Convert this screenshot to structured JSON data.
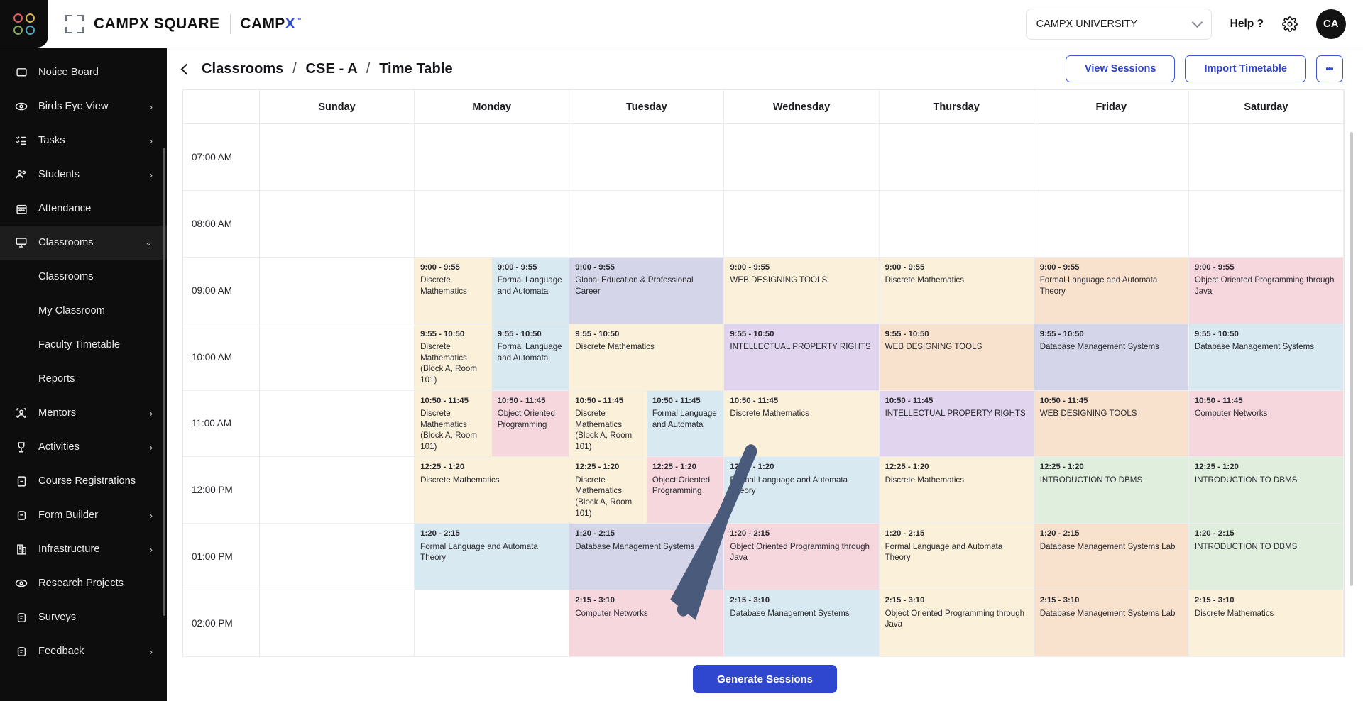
{
  "topbar": {
    "brand_name": "CAMPX SQUARE",
    "brand_sub": "CAMP",
    "brand_sub_x": "X",
    "brand_tm": "™",
    "org": "CAMPX UNIVERSITY",
    "help": "Help ?",
    "avatar": "CA"
  },
  "sidebar": {
    "items": [
      {
        "label": "Notice Board",
        "icon": "board-icon",
        "arrow": "",
        "active": false
      },
      {
        "label": "Birds Eye View",
        "icon": "eye-icon",
        "arrow": "›",
        "active": false
      },
      {
        "label": "Tasks",
        "icon": "tasks-icon",
        "arrow": "›",
        "active": false
      },
      {
        "label": "Students",
        "icon": "students-icon",
        "arrow": "›",
        "active": false
      },
      {
        "label": "Attendance",
        "icon": "calendar-icon",
        "arrow": "",
        "active": false
      },
      {
        "label": "Classrooms",
        "icon": "monitor-icon",
        "arrow": "⌄",
        "active": true
      }
    ],
    "sub_items": [
      {
        "label": "Classrooms"
      },
      {
        "label": "My Classroom"
      },
      {
        "label": "Faculty Timetable"
      },
      {
        "label": "Reports"
      }
    ],
    "items2": [
      {
        "label": "Mentors",
        "icon": "mentor-icon",
        "arrow": "›"
      },
      {
        "label": "Activities",
        "icon": "trophy-icon",
        "arrow": "›"
      },
      {
        "label": "Course Registrations",
        "icon": "doc-icon",
        "arrow": ""
      },
      {
        "label": "Form Builder",
        "icon": "form-icon",
        "arrow": "›"
      },
      {
        "label": "Infrastructure",
        "icon": "building-icon",
        "arrow": "›"
      },
      {
        "label": "Research Projects",
        "icon": "eye-icon",
        "arrow": ""
      },
      {
        "label": "Surveys",
        "icon": "survey-icon",
        "arrow": ""
      },
      {
        "label": "Feedback",
        "icon": "feedback-icon",
        "arrow": "›"
      }
    ]
  },
  "page": {
    "breadcrumb_1": "Classrooms",
    "breadcrumb_2": "CSE - A",
    "breadcrumb_3": "Time Table",
    "sep": "/",
    "btn_view_sessions": "View Sessions",
    "btn_import_timetable": "Import Timetable",
    "btn_generate_sessions": "Generate Sessions"
  },
  "calendar": {
    "days": [
      "Sunday",
      "Monday",
      "Tuesday",
      "Wednesday",
      "Thursday",
      "Friday",
      "Saturday"
    ],
    "times": [
      "07:00 AM",
      "08:00 AM",
      "09:00 AM",
      "10:00 AM",
      "11:00 AM",
      "12:00 PM",
      "01:00 PM",
      "02:00 PM"
    ],
    "colors": {
      "cream": "#fbf0d9",
      "blue": "#d9e9f2",
      "lavender": "#d4d5e8",
      "purple": "#e0d4ee",
      "peach": "#f9e2cd",
      "pink": "#f6d7de",
      "green": "#dfeedd"
    },
    "rows": [
      {
        "time": "07:00 AM",
        "cells": [
          [],
          [],
          [],
          [],
          [],
          [],
          []
        ]
      },
      {
        "time": "08:00 AM",
        "cells": [
          [],
          [],
          [],
          [],
          [],
          [],
          []
        ]
      },
      {
        "time": "09:00 AM",
        "cells": [
          [],
          [
            {
              "time": "9:00 - 9:55",
              "name": "Discrete Mathematics",
              "color": "cream"
            },
            {
              "time": "9:00 - 9:55",
              "name": "Formal Language and Automata",
              "color": "blue"
            }
          ],
          [
            {
              "time": "9:00 - 9:55",
              "name": "Global Education & Professional Career",
              "color": "lavender"
            }
          ],
          [
            {
              "time": "9:00 - 9:55",
              "name": "WEB DESIGNING TOOLS",
              "color": "cream"
            }
          ],
          [
            {
              "time": "9:00 - 9:55",
              "name": "Discrete Mathematics",
              "color": "cream"
            }
          ],
          [
            {
              "time": "9:00 - 9:55",
              "name": "Formal Language and Automata Theory",
              "color": "peach"
            }
          ],
          [
            {
              "time": "9:00 - 9:55",
              "name": "Object Oriented Programming through Java",
              "color": "pink"
            }
          ]
        ]
      },
      {
        "time": "10:00 AM",
        "cells": [
          [],
          [
            {
              "time": "9:55 - 10:50",
              "name": "Discrete Mathematics (Block A, Room 101)",
              "color": "cream"
            },
            {
              "time": "9:55 - 10:50",
              "name": "Formal Language and Automata",
              "color": "blue"
            }
          ],
          [
            {
              "time": "9:55 - 10:50",
              "name": "Discrete Mathematics",
              "color": "cream"
            }
          ],
          [
            {
              "time": "9:55 - 10:50",
              "name": "INTELLECTUAL PROPERTY RIGHTS",
              "color": "purple"
            }
          ],
          [
            {
              "time": "9:55 - 10:50",
              "name": "WEB DESIGNING TOOLS",
              "color": "peach"
            }
          ],
          [
            {
              "time": "9:55 - 10:50",
              "name": "Database Management Systems",
              "color": "lavender"
            }
          ],
          [
            {
              "time": "9:55 - 10:50",
              "name": "Database Management Systems",
              "color": "blue"
            }
          ]
        ]
      },
      {
        "time": "11:00 AM",
        "cells": [
          [],
          [
            {
              "time": "10:50 - 11:45",
              "name": "Discrete Mathematics (Block A, Room 101)",
              "color": "cream"
            },
            {
              "time": "10:50 - 11:45",
              "name": "Object Oriented Programming",
              "color": "pink"
            }
          ],
          [
            {
              "time": "10:50 - 11:45",
              "name": "Discrete Mathematics (Block A, Room 101)",
              "color": "cream"
            },
            {
              "time": "10:50 - 11:45",
              "name": "Formal Language and Automata",
              "color": "blue"
            }
          ],
          [
            {
              "time": "10:50 - 11:45",
              "name": "Discrete Mathematics",
              "color": "cream"
            }
          ],
          [
            {
              "time": "10:50 - 11:45",
              "name": "INTELLECTUAL PROPERTY RIGHTS",
              "color": "purple"
            }
          ],
          [
            {
              "time": "10:50 - 11:45",
              "name": "WEB DESIGNING TOOLS",
              "color": "peach"
            }
          ],
          [
            {
              "time": "10:50 - 11:45",
              "name": "Computer Networks",
              "color": "pink"
            }
          ]
        ]
      },
      {
        "time": "12:00 PM",
        "cells": [
          [],
          [
            {
              "time": "12:25 - 1:20",
              "name": "Discrete Mathematics",
              "color": "cream"
            }
          ],
          [
            {
              "time": "12:25 - 1:20",
              "name": "Discrete Mathematics (Block A, Room 101)",
              "color": "cream"
            },
            {
              "time": "12:25 - 1:20",
              "name": "Object Oriented Programming",
              "color": "pink"
            }
          ],
          [
            {
              "time": "12:25 - 1:20",
              "name": "Formal Language and Automata Theory",
              "color": "blue"
            }
          ],
          [
            {
              "time": "12:25 - 1:20",
              "name": "Discrete Mathematics",
              "color": "cream"
            }
          ],
          [
            {
              "time": "12:25 - 1:20",
              "name": "INTRODUCTION TO DBMS",
              "color": "green"
            }
          ],
          [
            {
              "time": "12:25 - 1:20",
              "name": "INTRODUCTION TO DBMS",
              "color": "green"
            }
          ]
        ]
      },
      {
        "time": "01:00 PM",
        "cells": [
          [],
          [
            {
              "time": "1:20 - 2:15",
              "name": "Formal Language and Automata Theory",
              "color": "blue"
            }
          ],
          [
            {
              "time": "1:20 - 2:15",
              "name": "Database Management Systems",
              "color": "lavender"
            }
          ],
          [
            {
              "time": "1:20 - 2:15",
              "name": "Object Oriented Programming through Java",
              "color": "pink"
            }
          ],
          [
            {
              "time": "1:20 - 2:15",
              "name": "Formal Language and Automata Theory",
              "color": "cream"
            }
          ],
          [
            {
              "time": "1:20 - 2:15",
              "name": "Database Management Systems Lab",
              "color": "peach"
            }
          ],
          [
            {
              "time": "1:20 - 2:15",
              "name": "INTRODUCTION TO DBMS",
              "color": "green"
            }
          ]
        ]
      },
      {
        "time": "02:00 PM",
        "cells": [
          [],
          [],
          [
            {
              "time": "2:15 - 3:10",
              "name": "Computer Networks",
              "color": "pink"
            }
          ],
          [
            {
              "time": "2:15 - 3:10",
              "name": "Database Management Systems",
              "color": "blue"
            }
          ],
          [
            {
              "time": "2:15 - 3:10",
              "name": "Object Oriented Programming through Java",
              "color": "cream"
            }
          ],
          [
            {
              "time": "2:15 - 3:10",
              "name": "Database Management Systems Lab",
              "color": "peach"
            }
          ],
          [
            {
              "time": "2:15 - 3:10",
              "name": "Discrete Mathematics",
              "color": "cream"
            }
          ]
        ]
      }
    ]
  }
}
